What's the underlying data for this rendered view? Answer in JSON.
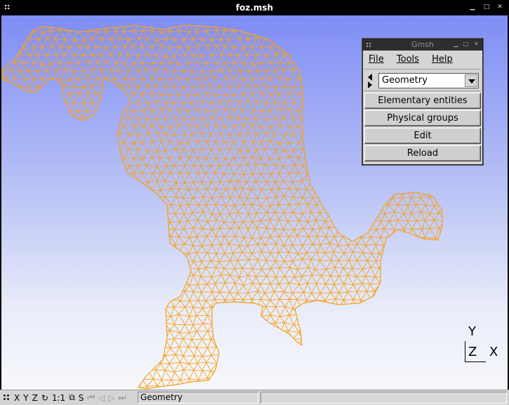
{
  "window": {
    "title": "foz.msh"
  },
  "axes": {
    "y": "Y",
    "z": "Z",
    "x": "X"
  },
  "gmsh_panel": {
    "title": "Gmsh",
    "menu": [
      "File",
      "Tools",
      "Help"
    ],
    "module_select": "Geometry",
    "buttons": [
      "Elementary entities",
      "Physical groups",
      "Edit",
      "Reload"
    ]
  },
  "statusbar": {
    "x": "X",
    "y": "Y",
    "z": "Z",
    "ratio": "1:1",
    "s": "S",
    "message": "Geometry",
    "message2": ""
  },
  "colors": {
    "mesh": "#f5a11c",
    "background_top": "#7f8df5",
    "background_bottom": "#f7f8fc"
  }
}
